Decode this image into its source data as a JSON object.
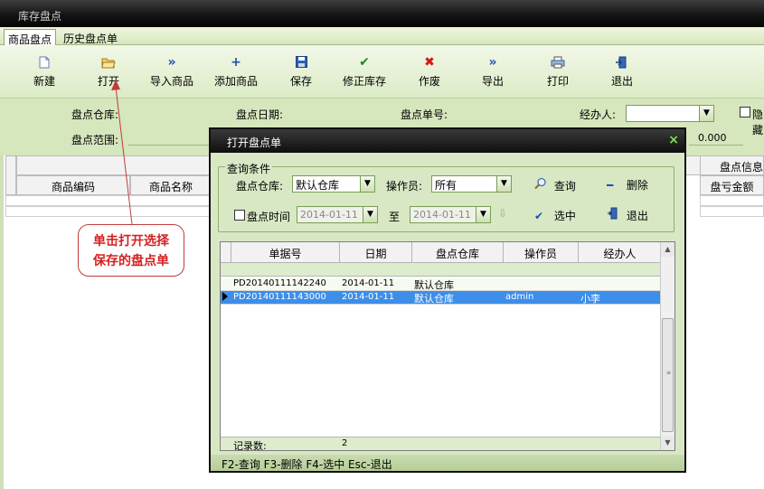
{
  "window": {
    "title": "库存盘点"
  },
  "tabs": [
    {
      "label": "商品盘点"
    },
    {
      "label": "历史盘点单"
    }
  ],
  "toolbar": {
    "buttons": [
      {
        "label": "新建",
        "icon": "new-doc-icon"
      },
      {
        "label": "打开",
        "icon": "folder-open-icon"
      },
      {
        "label": "导入商品",
        "icon": "double-chevron-icon"
      },
      {
        "label": "添加商品",
        "icon": "plus-icon"
      },
      {
        "label": "保存",
        "icon": "save-disk-icon"
      },
      {
        "label": "修正库存",
        "icon": "check-icon"
      },
      {
        "label": "作废",
        "icon": "cross-icon"
      },
      {
        "label": "导出",
        "icon": "export-icon"
      },
      {
        "label": "打印",
        "icon": "printer-icon"
      },
      {
        "label": "退出",
        "icon": "exit-door-icon"
      }
    ]
  },
  "filters": {
    "warehouse_label": "盘点仓库:",
    "date_label": "盘点日期:",
    "order_no_label": "盘点单号:",
    "handler_label": "经办人:",
    "hidden_label": "隐藏",
    "scope_label": "盘点范围:",
    "amount_value": "0.000"
  },
  "main_grid": {
    "columns": [
      "商品编码",
      "商品名称",
      "盘点信息",
      "盘亏金额"
    ]
  },
  "callout": {
    "line1": "单击打开选择",
    "line2": "保存的盘点单"
  },
  "dialog": {
    "title": "打开盘点单",
    "close_glyph": "×",
    "query_group_label": "查询条件",
    "warehouse_label": "盘点仓库:",
    "warehouse_value": "默认仓库",
    "operator_label": "操作员:",
    "operator_value": "所有",
    "query_button": "查询",
    "delete_button": "删除",
    "date_checkbox_label": "盘点时间",
    "date_from": "2014-01-11",
    "to_label": "至",
    "date_to": "2014-01-11",
    "select_button": "选中",
    "exit_button": "退出",
    "grid": {
      "columns": [
        "单据号",
        "日期",
        "盘点仓库",
        "操作员",
        "经办人"
      ],
      "rows": [
        {
          "order_no": "PD20140111142240",
          "date": "2014-01-11",
          "warehouse": "默认仓库",
          "operator": "",
          "handler": ""
        },
        {
          "order_no": "PD20140111143000",
          "date": "2014-01-11",
          "warehouse": "默认仓库",
          "operator": "admin",
          "handler": "小李"
        }
      ],
      "footer_label": "记录数:",
      "footer_count": "2"
    },
    "status_bar": "F2-查询 F3-删除 F4-选中 Esc-退出"
  }
}
